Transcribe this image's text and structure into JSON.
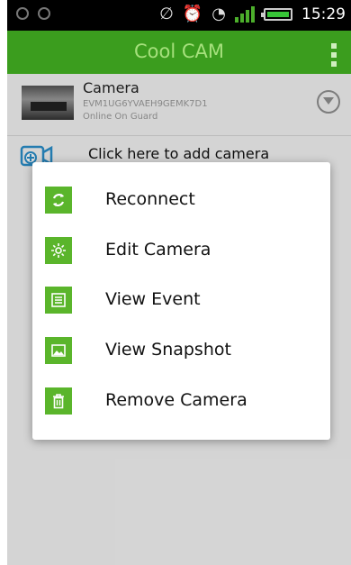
{
  "status_bar": {
    "time": "15:29",
    "accent_signal": "#4caf2b",
    "accent_battery": "#37c437"
  },
  "app_bar": {
    "title": "Cool CAM",
    "color": "#3b9d1e"
  },
  "camera": {
    "name": "Camera",
    "uid": "EVM1UG6YVAEH9GEMK7D1",
    "status": "Online   On Guard"
  },
  "add_camera": {
    "label": "Click here to add camera"
  },
  "context_menu": {
    "items": [
      {
        "label": "Reconnect",
        "icon": "refresh-icon"
      },
      {
        "label": "Edit Camera",
        "icon": "gear-icon"
      },
      {
        "label": "View Event",
        "icon": "list-icon"
      },
      {
        "label": "View Snapshot",
        "icon": "image-icon"
      },
      {
        "label": "Remove Camera",
        "icon": "trash-icon"
      }
    ],
    "accent": "#5ab52b"
  }
}
